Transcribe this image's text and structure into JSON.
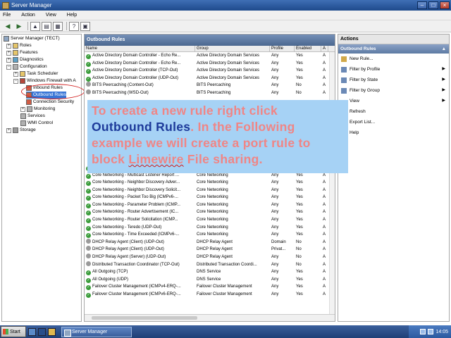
{
  "window": {
    "title": "Server Manager"
  },
  "menu": [
    "File",
    "Action",
    "View",
    "Help"
  ],
  "tree": [
    {
      "label": "Server Manager (TECT)",
      "icon": "server-icon"
    },
    {
      "label": "Roles",
      "icon": "roles-icon"
    },
    {
      "label": "Features",
      "icon": "features-icon"
    },
    {
      "label": "Diagnostics",
      "icon": "diagnostics-icon"
    },
    {
      "label": "Configuration",
      "icon": "configuration-icon"
    },
    {
      "label": "Task Scheduler",
      "icon": "task-scheduler-icon"
    },
    {
      "label": "Windows Firewall with A",
      "icon": "firewall-icon"
    },
    {
      "label": "Inbound Rules",
      "icon": "inbound-rules-icon"
    },
    {
      "label": "Outbound Rules",
      "icon": "outbound-rules-icon"
    },
    {
      "label": "Connection Security",
      "icon": "connection-security-icon"
    },
    {
      "label": "Monitoring",
      "icon": "monitoring-icon"
    },
    {
      "label": "Services",
      "icon": "services-icon"
    },
    {
      "label": "WMI Control",
      "icon": "wmi-icon"
    },
    {
      "label": "Storage",
      "icon": "storage-icon"
    }
  ],
  "center": {
    "title": "Outbound Rules",
    "columns": [
      "Name",
      "Group",
      "Profile",
      "Enabled",
      "A"
    ],
    "rows": [
      [
        "Active Directory Domain Controller - Echo Re...",
        "Active Directory Domain Services",
        "Any",
        "Yes",
        "A"
      ],
      [
        "Active Directory Domain Controller - Echo Re...",
        "Active Directory Domain Services",
        "Any",
        "Yes",
        "A"
      ],
      [
        "Active Directory Domain Controller (TCP-Out)",
        "Active Directory Domain Services",
        "Any",
        "Yes",
        "A"
      ],
      [
        "Active Directory Domain Controller (UDP-Out)",
        "Active Directory Domain Services",
        "Any",
        "Yes",
        "A"
      ],
      [
        "BITS Peercaching (Content-Out)",
        "BITS Peercaching",
        "Any",
        "No",
        "A"
      ],
      [
        "BITS Peercaching (WSD-Out)",
        "BITS Peercaching",
        "Any",
        "No",
        "A"
      ],
      [
        "",
        "",
        "",
        "",
        ""
      ],
      [
        "",
        "",
        "",
        "",
        ""
      ],
      [
        "",
        "",
        "",
        "",
        ""
      ],
      [
        "",
        "",
        "",
        "",
        ""
      ],
      [
        "",
        "",
        "",
        "",
        ""
      ],
      [
        "",
        "",
        "",
        "",
        ""
      ],
      [
        "",
        "",
        "",
        "",
        ""
      ],
      [
        "",
        "",
        "",
        "",
        ""
      ],
      [
        "",
        "",
        "",
        "",
        ""
      ],
      [
        "Core Networking - Multicast Listener Report ...",
        "Core Networking",
        "Any",
        "Yes",
        "A"
      ],
      [
        "Core Networking - Multicast Listener Report ...",
        "Core Networking",
        "Any",
        "Yes",
        "A"
      ],
      [
        "Core Networking - Neighbor Discovery Adver...",
        "Core Networking",
        "Any",
        "Yes",
        "A"
      ],
      [
        "Core Networking - Neighbor Discovery Solicit...",
        "Core Networking",
        "Any",
        "Yes",
        "A"
      ],
      [
        "Core Networking - Packet Too Big (ICMPv6-...",
        "Core Networking",
        "Any",
        "Yes",
        "A"
      ],
      [
        "Core Networking - Parameter Problem (ICMP...",
        "Core Networking",
        "Any",
        "Yes",
        "A"
      ],
      [
        "Core Networking - Router Advertisement (IC...",
        "Core Networking",
        "Any",
        "Yes",
        "A"
      ],
      [
        "Core Networking - Router Solicitation (ICMP...",
        "Core Networking",
        "Any",
        "Yes",
        "A"
      ],
      [
        "Core Networking - Teredo (UDP-Out)",
        "Core Networking",
        "Any",
        "Yes",
        "A"
      ],
      [
        "Core Networking - Time Exceeded (ICMPv6-...",
        "Core Networking",
        "Any",
        "Yes",
        "A"
      ],
      [
        "DHCP Relay Agent (Client) (UDP-Out)",
        "DHCP Relay Agent",
        "Domain",
        "No",
        "A"
      ],
      [
        "DHCP Relay Agent (Client) (UDP-Out)",
        "DHCP Relay Agent",
        "Privat...",
        "No",
        "A"
      ],
      [
        "DHCP Relay Agent (Server) (UDP-Out)",
        "DHCP Relay Agent",
        "Any",
        "No",
        "A"
      ],
      [
        "Distributed Transaction Coordinator (TCP-Out)",
        "Distributed Transaction Coordi...",
        "Any",
        "No",
        "A"
      ],
      [
        "All Outgoing (TCP)",
        "DNS Service",
        "Any",
        "Yes",
        "A"
      ],
      [
        "All Outgoing (UDP)",
        "DNS Service",
        "Any",
        "Yes",
        "A"
      ],
      [
        "Failover Cluster Management (ICMPv4-ERQ-...",
        "Failover Cluster Management",
        "Any",
        "Yes",
        "A"
      ],
      [
        "Failover Cluster Management (ICMPv6-ERQ-...",
        "Failover Cluster Management",
        "Any",
        "Yes",
        "A"
      ]
    ]
  },
  "actions": {
    "title": "Actions",
    "subtitle": "Outbound Rules",
    "items": [
      "New Rule...",
      "Filter by Profile",
      "Filter by State",
      "Filter by Group",
      "View",
      "Refresh",
      "Export List...",
      "Help"
    ]
  },
  "overlay": {
    "line1": "To create a new rule right click",
    "bold": "Outbound Rules",
    "rest": ". In the Following example we will create a port rule to block ",
    "lw": "Limewire",
    "end": " File sharing."
  },
  "taskbar": {
    "start": "Start",
    "item": "Server Manager",
    "clock": "14:05"
  }
}
